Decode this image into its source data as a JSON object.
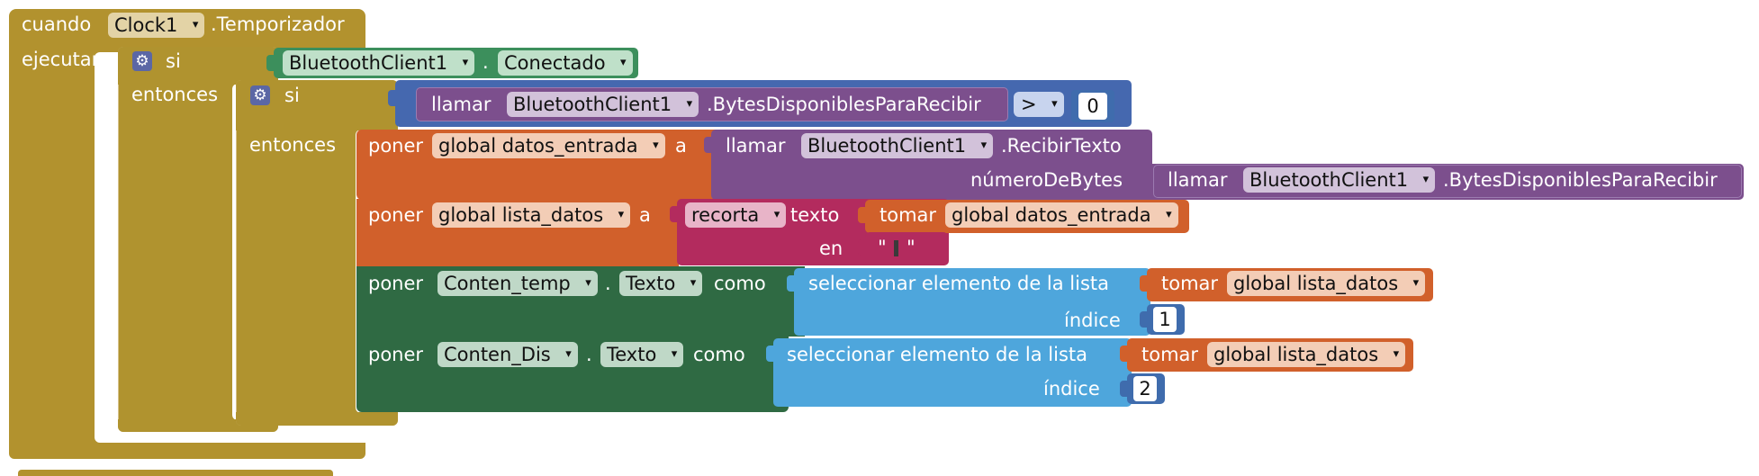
{
  "event": {
    "when_label": "cuando",
    "component": "Clock1",
    "event_name": ".Temporizador",
    "do_label": "ejecutar"
  },
  "outer_if": {
    "if_label": "si",
    "then_label": "entonces",
    "condition": {
      "component": "BluetoothClient1",
      "dot": ".",
      "property": "Conectado"
    }
  },
  "inner_if": {
    "if_label": "si",
    "then_label": "entonces",
    "compare": {
      "call_label": "llamar",
      "component": "BluetoothClient1",
      "method": ".BytesDisponiblesParaRecibir",
      "operator": ">",
      "value": "0"
    }
  },
  "set_datos_entrada": {
    "set_label": "poner",
    "variable": "global datos_entrada",
    "to_label": "a",
    "call_label": "llamar",
    "component": "BluetoothClient1",
    "method": ".RecibirTexto",
    "param_label": "númeroDeBytes",
    "param_call_label": "llamar",
    "param_component": "BluetoothClient1",
    "param_method": ".BytesDisponiblesParaRecibir"
  },
  "set_lista_datos": {
    "set_label": "poner",
    "variable": "global lista_datos",
    "to_label": "a",
    "split_op": "recorta",
    "text_label": "texto",
    "get_label": "tomar",
    "get_variable": "global datos_entrada",
    "at_label": "en",
    "quote_open": "\"",
    "quote_close": "\""
  },
  "set_temp": {
    "set_label": "poner",
    "component": "Conten_temp",
    "dot": ".",
    "property": "Texto",
    "as_label": "como",
    "select_label": "seleccionar elemento de la lista",
    "get_label": "tomar",
    "get_variable": "global lista_datos",
    "index_label": "índice",
    "index_value": "1"
  },
  "set_dis": {
    "set_label": "poner",
    "component": "Conten_Dis",
    "dot": ".",
    "property": "Texto",
    "as_label": "como",
    "select_label": "seleccionar elemento de la lista",
    "get_label": "tomar",
    "get_variable": "global lista_datos",
    "index_label": "índice",
    "index_value": "2"
  },
  "dropdown_arrow": "▾",
  "gear_icon": "⚙"
}
